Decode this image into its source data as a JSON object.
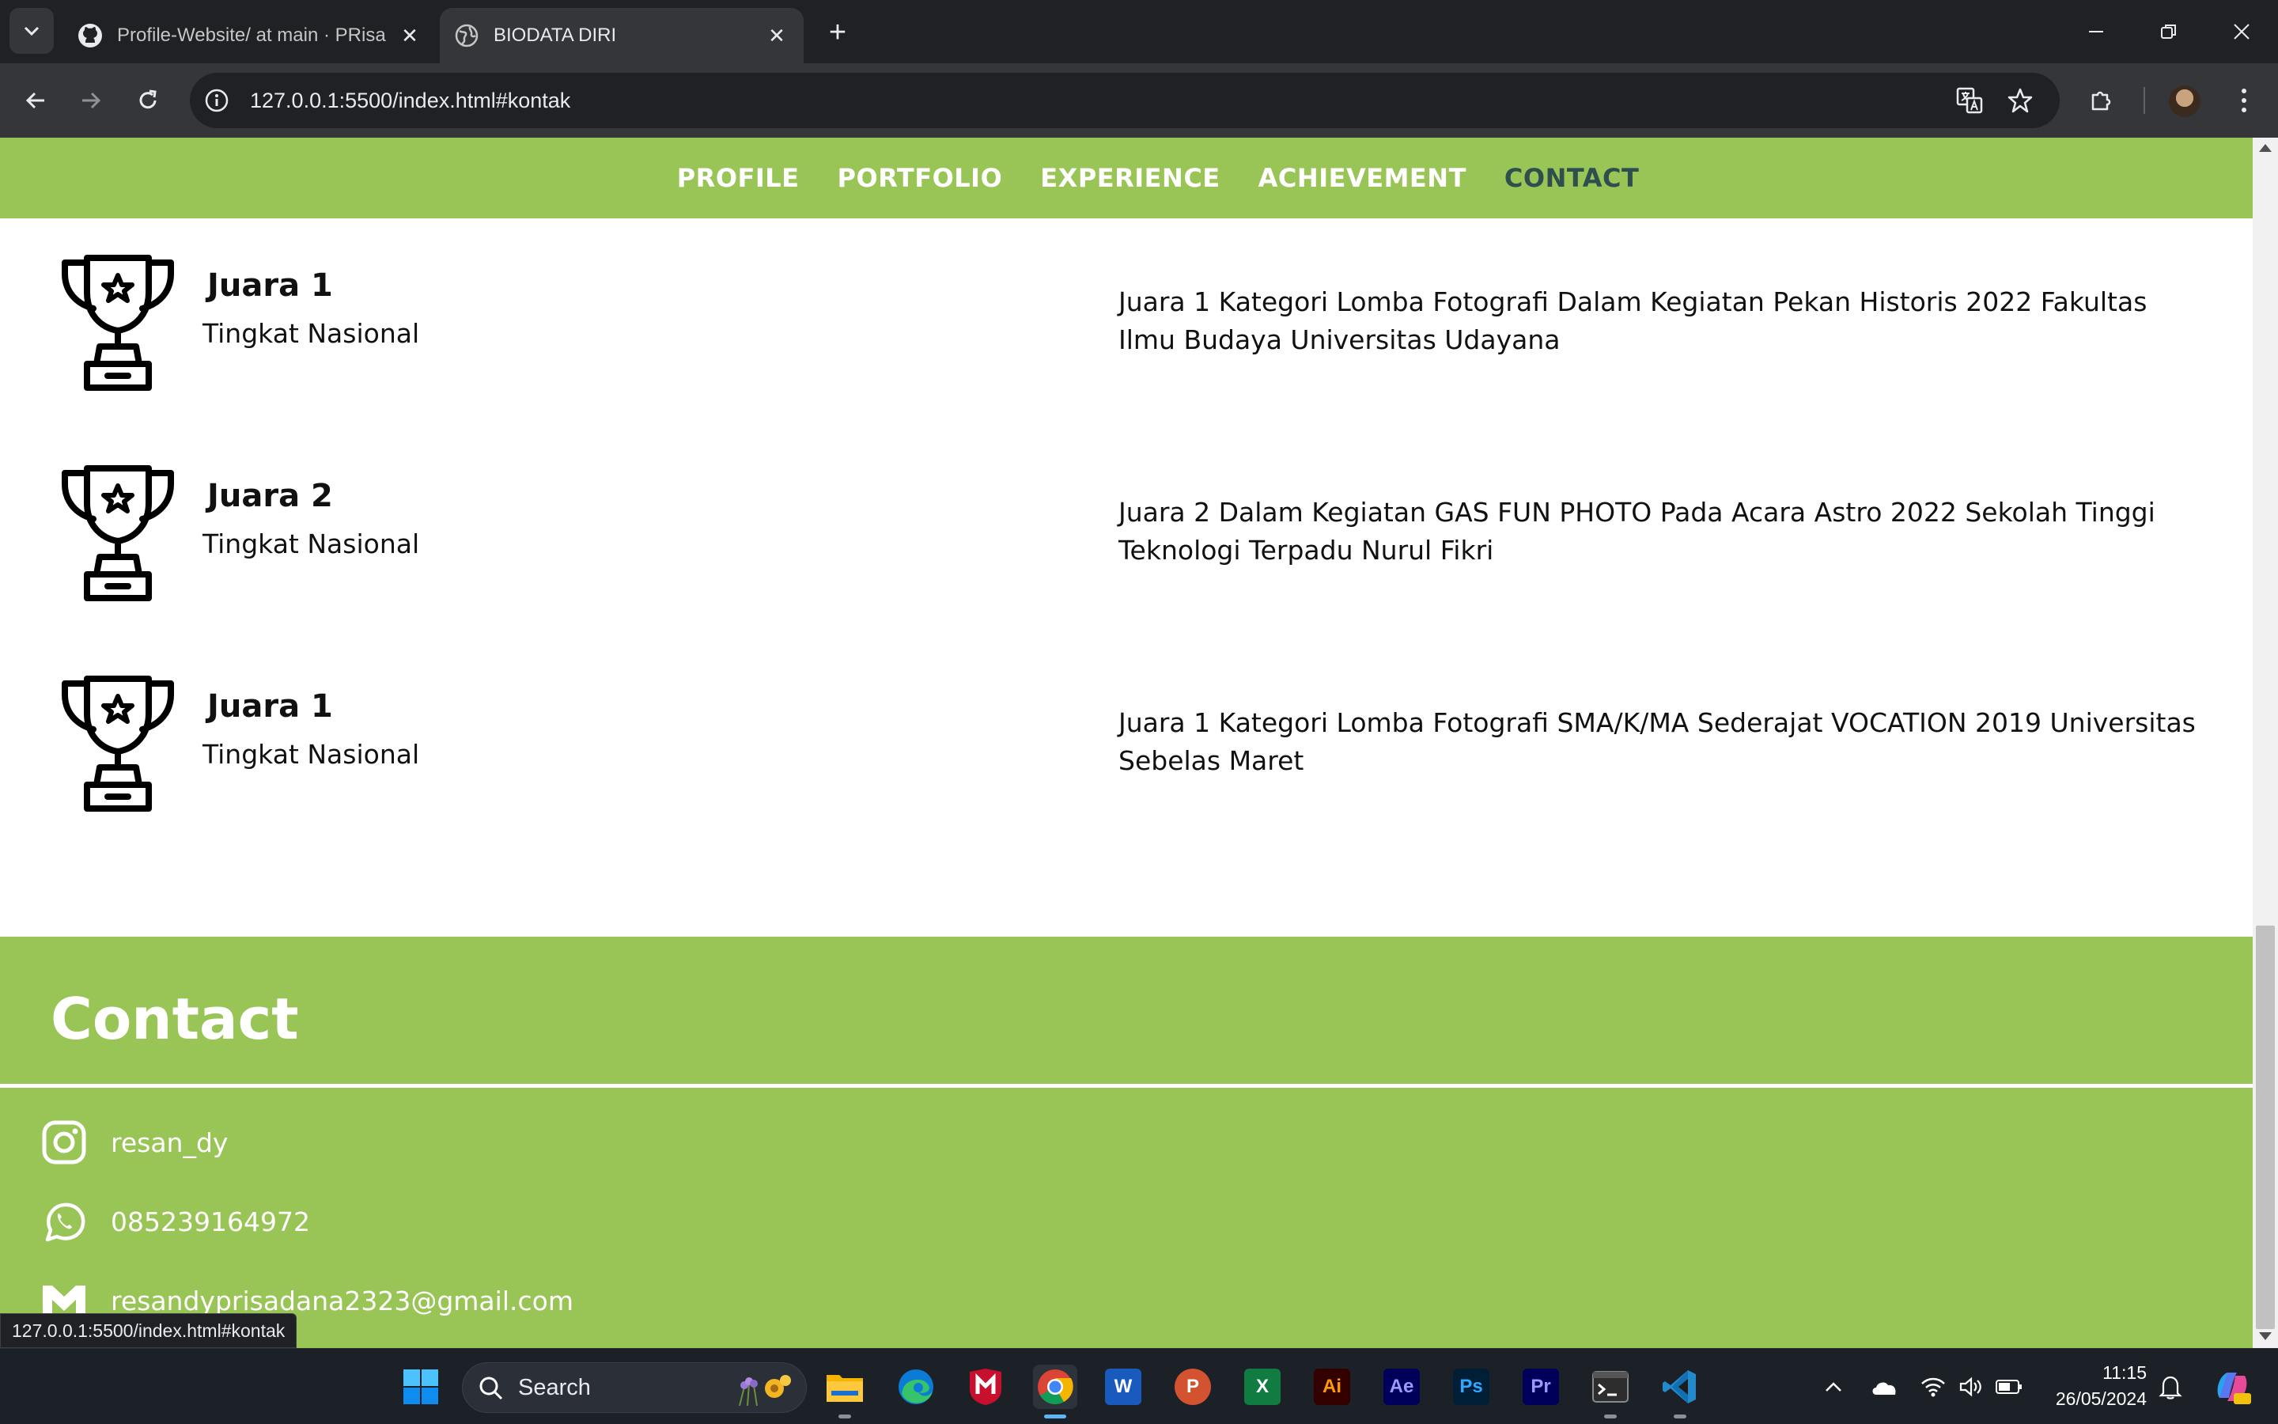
{
  "browser": {
    "tabs": [
      {
        "title": "Profile-Website/ at main · PRisa",
        "icon": "github-icon",
        "active": false
      },
      {
        "title": "BIODATA DIRI",
        "icon": "globe-icon",
        "active": true
      }
    ],
    "url": "127.0.0.1:5500/index.html#kontak",
    "status_url": "127.0.0.1:5500/index.html#kontak"
  },
  "site": {
    "nav": [
      {
        "label": "PROFILE"
      },
      {
        "label": "PORTFOLIO"
      },
      {
        "label": "EXPERIENCE"
      },
      {
        "label": "ACHIEVEMENT"
      },
      {
        "label": "CONTACT"
      }
    ],
    "achievements": [
      {
        "rank": "Juara 1",
        "level": "Tingkat Nasional",
        "description": "Juara 1 Kategori Lomba Fotografi Dalam Kegiatan Pekan Historis 2022 Fakultas Ilmu Budaya Universitas Udayana"
      },
      {
        "rank": "Juara 2",
        "level": "Tingkat Nasional",
        "description": "Juara 2 Dalam Kegiatan GAS FUN PHOTO Pada Acara Astro 2022 Sekolah Tinggi Teknologi Terpadu Nurul Fikri"
      },
      {
        "rank": "Juara 1",
        "level": "Tingkat Nasional",
        "description": "Juara 1 Kategori Lomba Fotografi SMA/K/MA Sederajat VOCATION 2019 Universitas Sebelas Maret"
      }
    ],
    "contact": {
      "title": "Contact",
      "instagram": "resan_dy",
      "whatsapp": "085239164972",
      "email": "resandyprisadana2323@gmail.com"
    },
    "colors": {
      "accent": "#99c456",
      "active_nav": "#2f4f4f"
    }
  },
  "taskbar": {
    "search_label": "Search",
    "apps": [
      "windows-start",
      "file-explorer",
      "edge",
      "mcafee",
      "chrome",
      "word",
      "powerpoint",
      "excel",
      "illustrator",
      "after-effects",
      "photoshop",
      "premiere",
      "terminal",
      "vscode"
    ],
    "app_labels": {
      "illustrator": "Ai",
      "after_effects": "Ae",
      "photoshop": "Ps",
      "premiere": "Pr"
    },
    "time": "11:15",
    "date": "26/05/2024"
  }
}
